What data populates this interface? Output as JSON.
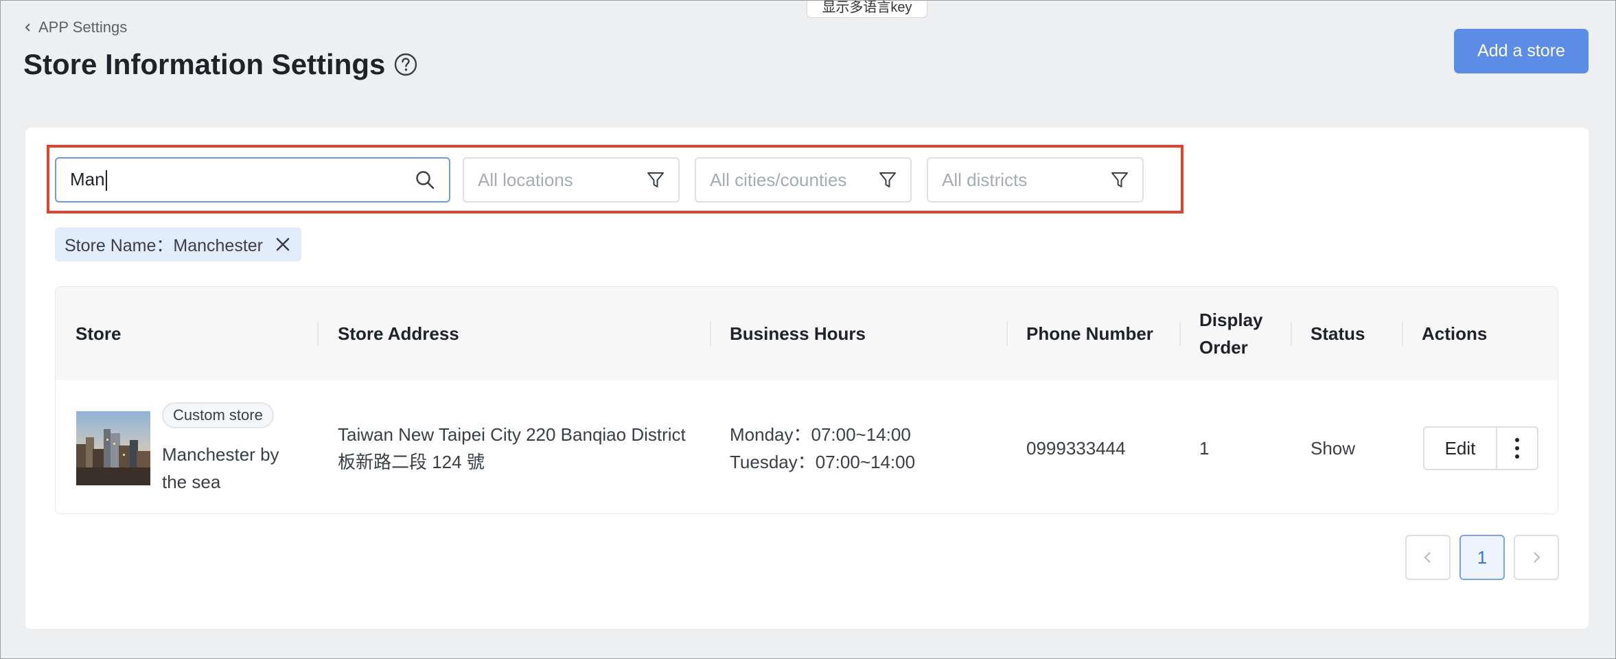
{
  "floating_tag": "显示多语言key",
  "header": {
    "back_label": "APP Settings",
    "title": "Store Information Settings",
    "add_store_label": "Add a store"
  },
  "filters": {
    "search_value": "Man",
    "location_placeholder": "All locations",
    "city_placeholder": "All cities/counties",
    "district_placeholder": "All districts"
  },
  "active_chip": {
    "label": "Store Name：Manchester"
  },
  "table": {
    "columns": [
      "Store",
      "Store Address",
      "Business Hours",
      "Phone Number",
      "Display Order",
      "Status",
      "Actions"
    ],
    "display_order_header_line1": "Display",
    "display_order_header_line2": "Order",
    "rows": [
      {
        "badge": "Custom store",
        "store_name_line1": "Manchester by",
        "store_name_line2": "the sea",
        "address_line1": "Taiwan New Taipei City 220 Banqiao District",
        "address_line2": "板新路二段 124 號",
        "hours_line1": "Monday：07:00~14:00",
        "hours_line2": "Tuesday：07:00~14:00",
        "phone": "0999333444",
        "display_order": "1",
        "status": "Show",
        "edit_label": "Edit"
      }
    ]
  },
  "pagination": {
    "current_page": "1"
  },
  "colors": {
    "primary": "#5b8ce6",
    "highlight_border": "#e0432b",
    "chip_bg": "#e1edfb"
  }
}
